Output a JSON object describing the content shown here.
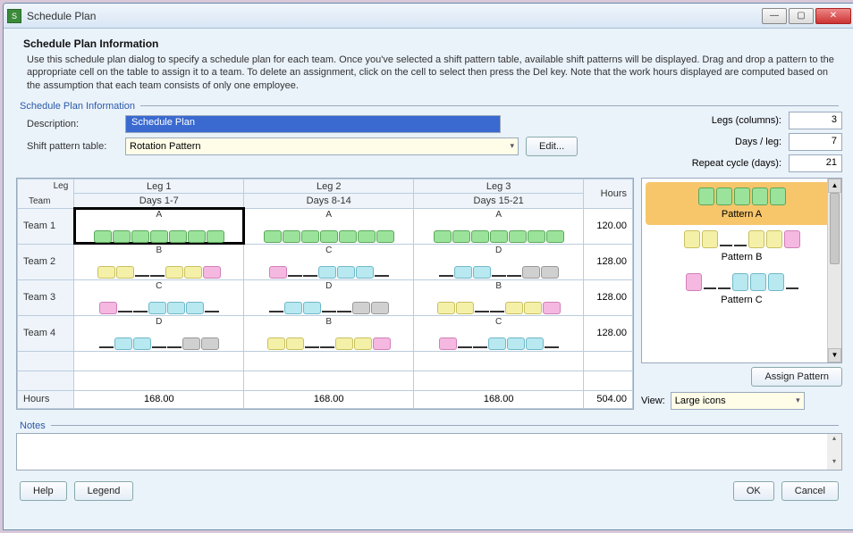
{
  "window": {
    "title": "Schedule Plan"
  },
  "header": {
    "title": "Schedule Plan Information",
    "help": "Use this schedule plan dialog to specify a schedule plan for each team. Once you've selected a shift pattern table, available shift patterns will be displayed. Drag and drop a pattern to the appropriate cell on the table to assign it to a team. To delete an assignment, click on the cell to select then press the Del key. Note that the work hours displayed are computed based on the assumption that each team consists of only one employee."
  },
  "fieldset_labels": {
    "info": "Schedule Plan Information",
    "notes": "Notes"
  },
  "form": {
    "description_label": "Description:",
    "description_value": "Schedule Plan",
    "pattern_table_label": "Shift pattern table:",
    "pattern_table_value": "Rotation Pattern",
    "edit_button": "Edit...",
    "legs_label": "Legs (columns):",
    "legs_value": "3",
    "days_leg_label": "Days / leg:",
    "days_leg_value": "7",
    "repeat_label": "Repeat cycle (days):",
    "repeat_value": "21"
  },
  "grid": {
    "corner_top": "Leg",
    "corner_bottom": "Team",
    "legs": [
      {
        "name": "Leg 1",
        "days": "Days 1-7"
      },
      {
        "name": "Leg 2",
        "days": "Days 8-14"
      },
      {
        "name": "Leg 3",
        "days": "Days 15-21"
      }
    ],
    "hours_header": "Hours",
    "rows": [
      {
        "team": "Team 1",
        "cells": [
          {
            "label": "A",
            "blocks": [
              "g",
              "g",
              "g",
              "g",
              "g",
              "g",
              "g"
            ],
            "selected": true
          },
          {
            "label": "A",
            "blocks": [
              "g",
              "g",
              "g",
              "g",
              "g",
              "g",
              "g"
            ]
          },
          {
            "label": "A",
            "blocks": [
              "g",
              "g",
              "g",
              "g",
              "g",
              "g",
              "g"
            ]
          }
        ],
        "hours": "120.00"
      },
      {
        "team": "Team 2",
        "cells": [
          {
            "label": "B",
            "blocks": [
              "y",
              "y",
              "-",
              "-",
              "y",
              "y",
              "p"
            ]
          },
          {
            "label": "C",
            "blocks": [
              "p",
              "-",
              "-",
              "c",
              "c",
              "c",
              "-"
            ]
          },
          {
            "label": "D",
            "blocks": [
              "-",
              "c",
              "c",
              "-",
              "-",
              "gr",
              "gr"
            ]
          }
        ],
        "hours": "128.00"
      },
      {
        "team": "Team 3",
        "cells": [
          {
            "label": "C",
            "blocks": [
              "p",
              "-",
              "-",
              "c",
              "c",
              "c",
              "-"
            ]
          },
          {
            "label": "D",
            "blocks": [
              "-",
              "c",
              "c",
              "-",
              "-",
              "gr",
              "gr"
            ]
          },
          {
            "label": "B",
            "blocks": [
              "y",
              "y",
              "-",
              "-",
              "y",
              "y",
              "p"
            ]
          }
        ],
        "hours": "128.00"
      },
      {
        "team": "Team 4",
        "cells": [
          {
            "label": "D",
            "blocks": [
              "-",
              "c",
              "c",
              "-",
              "-",
              "gr",
              "gr"
            ]
          },
          {
            "label": "B",
            "blocks": [
              "y",
              "y",
              "-",
              "-",
              "y",
              "y",
              "p"
            ]
          },
          {
            "label": "C",
            "blocks": [
              "p",
              "-",
              "-",
              "c",
              "c",
              "c",
              "-"
            ]
          }
        ],
        "hours": "128.00"
      }
    ],
    "hours_row_label": "Hours",
    "leg_hours": [
      "168.00",
      "168.00",
      "168.00"
    ],
    "total_hours": "504.00"
  },
  "palette": {
    "items": [
      {
        "name": "Pattern A",
        "blocks": [
          "g",
          "g",
          "g",
          "g",
          "g"
        ],
        "selected": true
      },
      {
        "name": "Pattern B",
        "blocks": [
          "y",
          "y",
          "-",
          "-",
          "y",
          "y",
          "p"
        ]
      },
      {
        "name": "Pattern C",
        "blocks": [
          "p",
          "-",
          "-",
          "c",
          "c",
          "c",
          "-"
        ]
      }
    ],
    "assign_button": "Assign Pattern",
    "view_label": "View:",
    "view_value": "Large icons"
  },
  "footer": {
    "help": "Help",
    "legend": "Legend",
    "ok": "OK",
    "cancel": "Cancel"
  }
}
